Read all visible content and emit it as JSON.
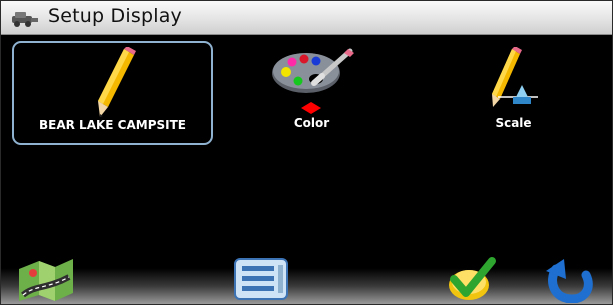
{
  "window": {
    "title": "Setup Display",
    "title_icon": "vehicle-icon"
  },
  "options": [
    {
      "label": "BEAR LAKE CAMPSITE",
      "icon": "pencil-icon",
      "selected": true
    },
    {
      "label": "Color",
      "icon": "palette-icon",
      "selected": false
    },
    {
      "label": "Scale",
      "icon": "pencil-scale-icon",
      "selected": false
    }
  ],
  "toolbar": {
    "buttons": [
      "map-icon",
      "menu-list-icon",
      "checkmark-icon",
      "back-arrow-icon"
    ]
  },
  "colors": {
    "background": "#000000",
    "selection_border": "#8fb2d0",
    "title_bar": "#e4e4e4",
    "pointer_red": "#ff0000"
  }
}
